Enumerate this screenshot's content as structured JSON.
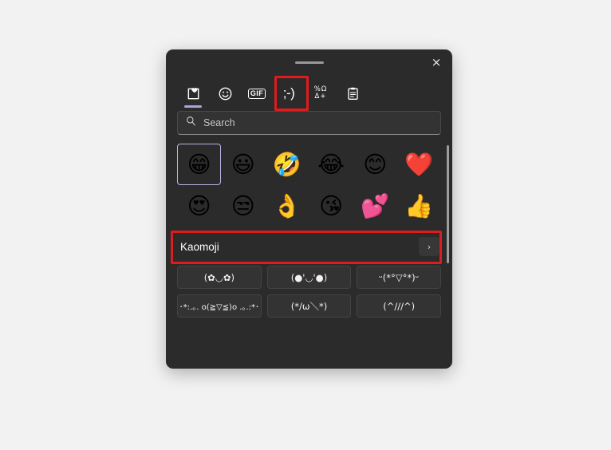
{
  "window": {
    "title": "Emoji Panel",
    "close_label": "×",
    "drag_handle_name": "drag-handle"
  },
  "tabs": [
    {
      "id": "recent",
      "label": "Recently used",
      "icon": "clipboard-heart-icon",
      "active": true,
      "annotated": false
    },
    {
      "id": "emoji",
      "label": "Emoji",
      "icon": "smiley-icon",
      "active": false,
      "annotated": false
    },
    {
      "id": "gif",
      "label": "GIF",
      "icon": "gif-icon",
      "glyph": "GIF",
      "active": false,
      "annotated": false
    },
    {
      "id": "kaomoji",
      "label": "Kaomoji",
      "icon": "wink-face-icon",
      "glyph": ";-)",
      "active": false,
      "annotated": true
    },
    {
      "id": "symbols",
      "label": "Symbols",
      "icon": "symbols-icon",
      "glyph_top": "%Ω",
      "glyph_bottom": "Δ+",
      "active": false,
      "annotated": false
    },
    {
      "id": "clipboard",
      "label": "Clipboard history",
      "icon": "clipboard-icon",
      "active": false,
      "annotated": false
    }
  ],
  "search": {
    "placeholder": "Search",
    "value": "",
    "icon": "search-icon"
  },
  "emoji_grid": {
    "selected_index": 0,
    "items": [
      {
        "char": "😁",
        "name": "grinning-face-with-smiling-eyes"
      },
      {
        "char": "😃",
        "name": "grinning-face-with-big-eyes"
      },
      {
        "char": "🤣",
        "name": "rolling-on-the-floor-laughing"
      },
      {
        "char": "😂",
        "name": "face-with-tears-of-joy"
      },
      {
        "char": "😊",
        "name": "smiling-face-with-smiling-eyes"
      },
      {
        "char": "❤️",
        "name": "red-heart"
      },
      {
        "char": "😍",
        "name": "smiling-face-with-heart-eyes"
      },
      {
        "char": "😒",
        "name": "unamused-face"
      },
      {
        "char": "👌",
        "name": "ok-hand"
      },
      {
        "char": "😘",
        "name": "face-blowing-a-kiss"
      },
      {
        "char": "💕",
        "name": "two-hearts"
      },
      {
        "char": "👍",
        "name": "thumbs-up"
      }
    ]
  },
  "kaomoji_section": {
    "title": "Kaomoji",
    "more_label": "›",
    "more_icon": "chevron-right-icon",
    "annotated": true,
    "items": [
      {
        "text": "(✿◡✿)",
        "name": "kaomoji-flower-eyes",
        "small": false
      },
      {
        "text": "(●'◡'●)",
        "name": "kaomoji-happy-blush",
        "small": false
      },
      {
        "text": "ᵕ(*°▽°*)ᵕ",
        "name": "kaomoji-cheerful",
        "small": false
      },
      {
        "text": "･*:.｡. o(≧▽≦)o .｡.:*･",
        "name": "kaomoji-sparkle-joy",
        "small": true
      },
      {
        "text": "(*/ω＼*)",
        "name": "kaomoji-shy",
        "small": false
      },
      {
        "text": "(^///^)",
        "name": "kaomoji-blushing",
        "small": false
      }
    ]
  },
  "scrollbar": {
    "name": "vertical-scrollbar",
    "position_percent": 0
  },
  "colors": {
    "panel_background": "#2b2b2b",
    "page_background": "#f2f2f2",
    "accent_underline": "#a8a4d8",
    "selection_border": "#b9b5e3",
    "annotation_red": "#e01b1b",
    "tile_background": "#333333",
    "text_primary": "#ffffff",
    "text_muted": "#c6c6c6"
  }
}
